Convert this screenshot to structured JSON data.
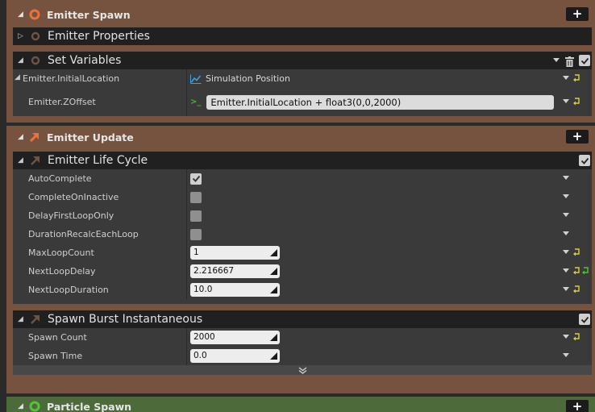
{
  "colors": {
    "emitter_stage": "#75533f",
    "particle_stage": "#4d6b3a",
    "accent_orange": "#e8743a",
    "reset_yellow": "#d8d23a",
    "reset_green": "#56c23a"
  },
  "emitter_spawn": {
    "title": "Emitter Spawn",
    "icon": "ring-icon",
    "add_icon": "+",
    "emitter_properties": {
      "title": "Emitter Properties",
      "icon": "ring-icon"
    },
    "set_variables": {
      "title": "Set Variables",
      "icon": "ring-icon",
      "rows": [
        {
          "label": "Emitter.InitialLocation",
          "value": "Simulation Position",
          "value_icon": "graph-icon"
        },
        {
          "label": "Emitter.ZOffset",
          "value": "Emitter.InitialLocation + float3(0,0,2000)",
          "value_icon": "console-icon"
        }
      ]
    }
  },
  "emitter_update": {
    "title": "Emitter Update",
    "icon": "orange-arrow-icon",
    "add_icon": "+",
    "life_cycle": {
      "title": "Emitter Life Cycle",
      "icon": "arrow-icon",
      "enabled": true,
      "rows": [
        {
          "label": "AutoComplete",
          "checked": true
        },
        {
          "label": "CompleteOnInactive",
          "checked": false
        },
        {
          "label": "DelayFirstLoopOnly",
          "checked": false
        },
        {
          "label": "DurationRecalcEachLoop",
          "checked": false
        },
        {
          "label": "MaxLoopCount",
          "value": "1"
        },
        {
          "label": "NextLoopDelay",
          "value": "2.216667"
        },
        {
          "label": "NextLoopDuration",
          "value": "10.0"
        }
      ]
    },
    "spawn_burst": {
      "title": "Spawn Burst Instantaneous",
      "icon": "arrow-icon",
      "enabled": true,
      "rows": [
        {
          "label": "Spawn Count",
          "value": "2000"
        },
        {
          "label": "Spawn Time",
          "value": "0.0"
        }
      ]
    }
  },
  "particle_spawn": {
    "title": "Particle Spawn",
    "icon": "green-ring-icon",
    "add_icon": "+"
  }
}
